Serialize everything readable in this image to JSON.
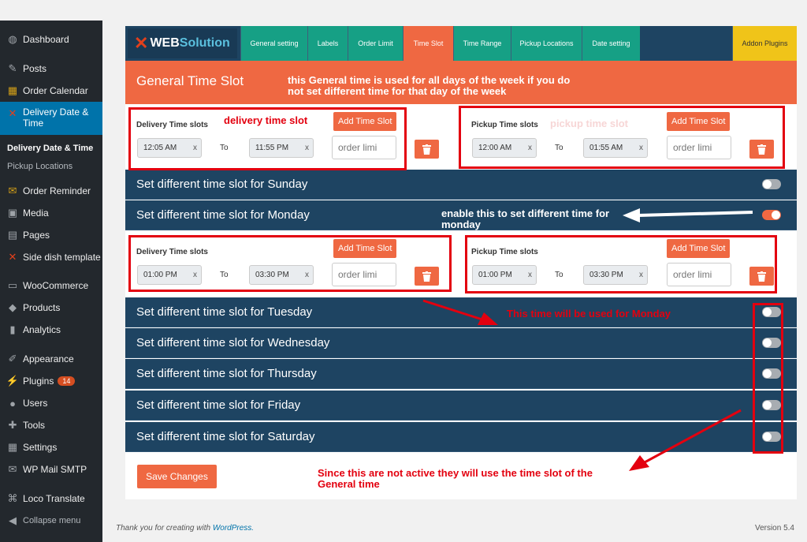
{
  "sidebar": {
    "items": [
      {
        "label": "Dashboard",
        "icon": "dashboard-icon"
      },
      {
        "label": "Posts",
        "icon": "pin-icon"
      },
      {
        "label": "Order Calendar",
        "icon": "calendar-icon"
      },
      {
        "label": "Delivery Date & Time",
        "icon": "delivery-date-icon"
      },
      {
        "label": "Order Reminder",
        "icon": "mail-icon"
      },
      {
        "label": "Media",
        "icon": "media-icon"
      },
      {
        "label": "Pages",
        "icon": "pages-icon"
      },
      {
        "label": "Side dish template",
        "icon": "template-icon"
      },
      {
        "label": "WooCommerce",
        "icon": "woo-icon"
      },
      {
        "label": "Products",
        "icon": "box-icon"
      },
      {
        "label": "Analytics",
        "icon": "bar-chart-icon"
      },
      {
        "label": "Appearance",
        "icon": "brush-icon"
      },
      {
        "label": "Plugins",
        "icon": "plug-icon",
        "badge": "14"
      },
      {
        "label": "Users",
        "icon": "user-icon"
      },
      {
        "label": "Tools",
        "icon": "wrench-icon"
      },
      {
        "label": "Settings",
        "icon": "settings-icon"
      },
      {
        "label": "WP Mail SMTP",
        "icon": "mail-send-icon"
      },
      {
        "label": "Loco Translate",
        "icon": "translate-icon"
      },
      {
        "label": "Collapse menu",
        "icon": "collapse-icon"
      }
    ],
    "subitems": [
      "Delivery Date & Time",
      "Pickup Locations"
    ]
  },
  "brand": {
    "logo_main": "WEB",
    "logo_accent": "Solution"
  },
  "tabs": [
    "General setting",
    "Labels",
    "Order Limit",
    "Time Slot",
    "Time Range",
    "Pickup Locations",
    "Date setting",
    "Addon Plugins"
  ],
  "header": {
    "title": "General Time Slot"
  },
  "general": {
    "delivery_label": "Delivery Time slots",
    "pickup_label": "Pickup Time slots",
    "add_label": "Add Time Slot",
    "to_label": "To",
    "clear": "x",
    "placeholder": "order limi",
    "delivery_from": "12:05 AM",
    "delivery_to": "11:55 PM",
    "pickup_from": "12:00 AM",
    "pickup_to": "01:55 AM"
  },
  "monday": {
    "delivery_from": "01:00 PM",
    "delivery_to": "03:30 PM",
    "pickup_from": "01:00 PM",
    "pickup_to": "03:30 PM"
  },
  "days": {
    "sunday": "Set different time slot for Sunday",
    "monday": "Set different time slot for Monday",
    "tuesday": "Set different time slot for Tuesday",
    "wednesday": "Set different time slot for Wednesday",
    "thursday": "Set different time slot for Thursday",
    "friday": "Set different time slot for Friday",
    "saturday": "Set different time slot for Saturday"
  },
  "toggles": {
    "sunday": false,
    "monday": true,
    "tuesday": false,
    "wednesday": false,
    "thursday": false,
    "friday": false,
    "saturday": false
  },
  "save_label": "Save Changes",
  "annotations": {
    "general_note": "this General time is used for all days of the week if you do not set different time for that day of the week",
    "delivery_note": "delivery time slot",
    "pickup_note": "pickup time slot",
    "monday_note": "enable this to set different time for monday",
    "used_note": "This time will be used for Monday",
    "inactive_note": "Since this are not active they will use the time slot of the General time"
  },
  "footer": {
    "thanks": "Thank you for creating with",
    "link": "WordPress.",
    "version": "Version 5.4"
  },
  "colors": {
    "accent": "#ef6842",
    "navy": "#1e4462",
    "annotation": "#e3000f"
  }
}
